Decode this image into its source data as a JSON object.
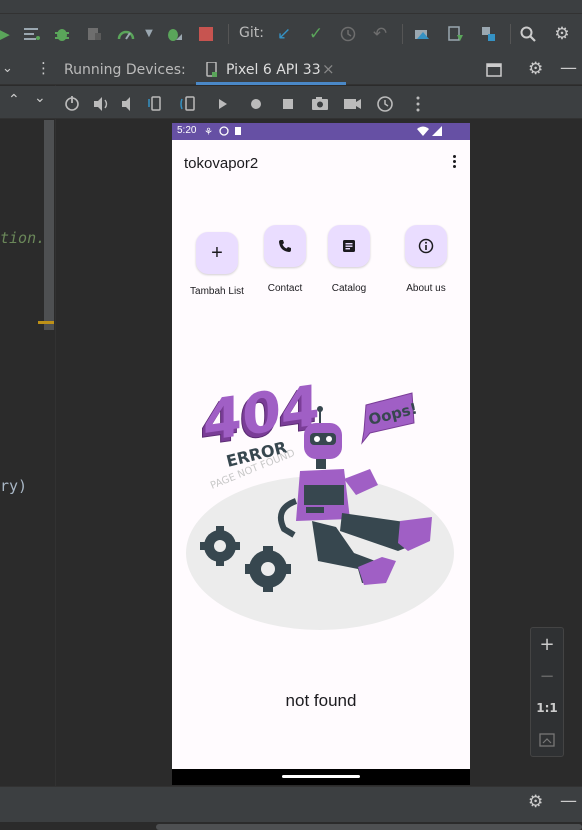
{
  "toolbar": {
    "git_label": "Git:",
    "icons": [
      "android-run-icon",
      "make-project-icon",
      "debug-icon",
      "attach-debugger-icon",
      "profile-icon",
      "apply-changes-icon",
      "stop-icon",
      "git-update-icon",
      "git-commit-icon",
      "git-history-icon",
      "git-rollback-icon",
      "device-manager-icon",
      "sdk-manager-icon",
      "project-structure-icon",
      "search-icon",
      "settings-icon"
    ]
  },
  "editor": {
    "code_fragment_1": "tion.",
    "code_fragment_2": "ry)"
  },
  "running_devices": {
    "title": "Running Devices:",
    "tab_label": "Pixel 6 API 33",
    "tab_close": "×",
    "controls": [
      "power-icon",
      "volume-up-icon",
      "volume-down-icon",
      "rotate-left-icon",
      "rotate-right-icon",
      "back-icon",
      "home-icon",
      "overview-icon",
      "screenshot-icon",
      "screen-record-icon",
      "snapshot-icon",
      "more-icon"
    ]
  },
  "phone": {
    "status_time": "5:20",
    "app_title": "tokovapor2",
    "actions": [
      {
        "label": "Tambah List",
        "icon": "+"
      },
      {
        "label": "Contact",
        "icon": "phone-icon"
      },
      {
        "label": "Catalog",
        "icon": "catalog-icon"
      },
      {
        "label": "About us",
        "icon": "info-icon"
      }
    ],
    "illustration": {
      "code": "404",
      "error": "ERROR",
      "subtitle": "PAGE NOT FOUND",
      "bubble": "Oops!"
    },
    "message": "not found"
  },
  "zoom": {
    "zoom_in": "+",
    "zoom_out": "−",
    "actual_size": "1:1"
  },
  "colors": {
    "accent": "#6650a4",
    "button_bg": "#eaddff",
    "robot": "#a05fc5",
    "ide_bg": "#2b2b2b",
    "ide_panel": "#3c3f41"
  }
}
